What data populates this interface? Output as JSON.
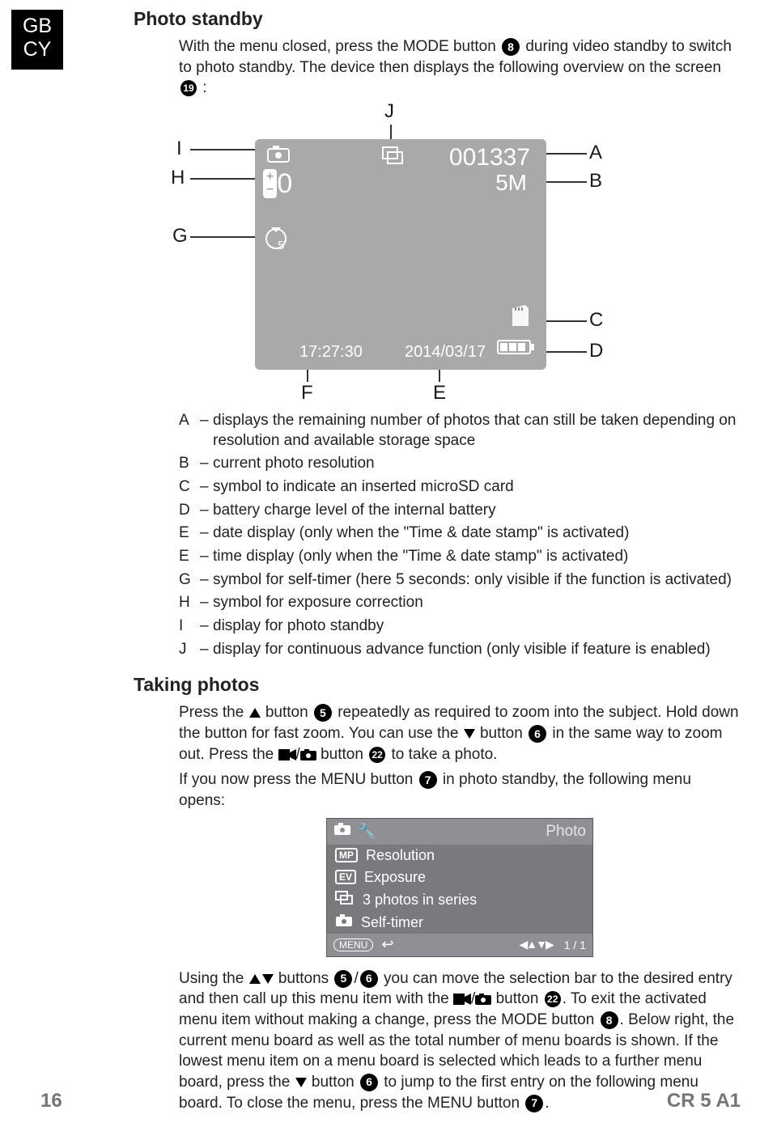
{
  "lang_tag": {
    "line1": "GB",
    "line2": "CY"
  },
  "sec1_title": "Photo standby",
  "intro": {
    "p1a": "With the menu closed, press the MODE button ",
    "p1_circ8": "8",
    "p1b": " during video standby to switch to photo standby. The device then displays the following overview on the screen ",
    "p1_circ19": "19",
    "p1c": ":"
  },
  "screen": {
    "counter": "001337",
    "resolution": "5M",
    "time": "17:27:30",
    "date": "2014/03/17",
    "ev": "0",
    "timer_sec": "5"
  },
  "callouts": {
    "A": "A",
    "B": "B",
    "C": "C",
    "D": "D",
    "E": "E",
    "F": "F",
    "G": "G",
    "H": "H",
    "I": "I",
    "J": "J"
  },
  "annotations": [
    {
      "label": "A",
      "text": "displays the remaining number of photos that can still be taken depending on resolution and available storage space"
    },
    {
      "label": "B",
      "text": "current photo resolution"
    },
    {
      "label": "C",
      "text": "symbol to indicate an inserted microSD card"
    },
    {
      "label": "D",
      "text": "battery charge level of the internal battery"
    },
    {
      "label": "E",
      "text": "date display (only when the \"Time & date stamp\" is activated)"
    },
    {
      "label": "E",
      "text": "time display (only when the \"Time & date stamp\" is activated)"
    },
    {
      "label": "G",
      "text": "symbol for self-timer (here 5 seconds: only visible if the function is activated)"
    },
    {
      "label": "H",
      "text": "symbol for exposure correction"
    },
    {
      "label": "I",
      "text": "display for photo standby"
    },
    {
      "label": "J",
      "text": "display for continuous advance function (only visible if feature is enabled)"
    }
  ],
  "sec2_title": "Taking photos",
  "taking": {
    "p1a": "Press the ",
    "p1b": " button ",
    "c5": "5",
    "p1c": " repeatedly as required to zoom into the subject. Hold down the button for fast zoom. You can use the ",
    "p1d": " button ",
    "c6": "6",
    "p1e": " in the same way to zoom out. Press the ",
    "p1f": " button ",
    "c22": "22",
    "p1g": " to take a photo.",
    "p2a": "If you now press the MENU button ",
    "c7": "7",
    "p2b": " in photo standby, the following menu opens:"
  },
  "menu": {
    "tab_label": "Photo",
    "items": [
      {
        "icon": "MP",
        "label": "Resolution"
      },
      {
        "icon": "EV",
        "label": "Exposure"
      },
      {
        "icon": "series",
        "label": "3 photos in series"
      },
      {
        "icon": "cam",
        "label": "Self-timer"
      }
    ],
    "footer_menu": "MENU",
    "footer_back": "↩",
    "footer_arrows": "◀▲▼▶",
    "footer_page": "1 / 1"
  },
  "closing": {
    "a": "Using the ",
    "b": " buttons ",
    "c5": "5",
    "c6": "6",
    "c": " you can move the selection bar to the desired entry and then call up this menu item with the ",
    "d": " button ",
    "c22": "22",
    "e": ". To exit the activated menu item without making a change, press the MODE button ",
    "c8": "8",
    "f": ". Below right, the current menu board as well as the total number of menu boards is shown. If the lowest menu item on a menu board is selected which leads to a further menu board, press the ",
    "g": " button ",
    "c6b": "6",
    "h": " to jump to the first entry on the following menu board. To close the menu, press the MENU button ",
    "c7": "7",
    "i": "."
  },
  "footer": {
    "page": "16",
    "model": "CR 5 A1"
  }
}
